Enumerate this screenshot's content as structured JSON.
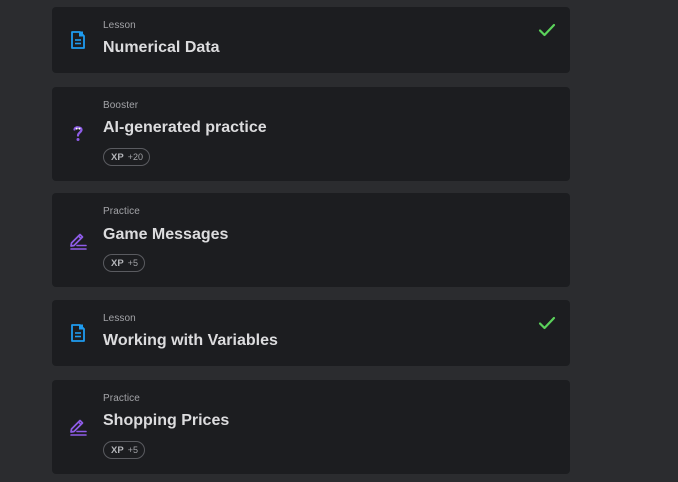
{
  "items": [
    {
      "type": "Lesson",
      "title": "Numerical Data",
      "icon": "document-icon",
      "completed": true
    },
    {
      "type": "Booster",
      "title": "AI-generated practice",
      "icon": "question-mark-icon",
      "xp_label": "XP",
      "xp_value": "+20"
    },
    {
      "type": "Practice",
      "title": "Game Messages",
      "icon": "pencil-lines-icon",
      "xp_label": "XP",
      "xp_value": "+5"
    },
    {
      "type": "Lesson",
      "title": "Working with Variables",
      "icon": "document-icon",
      "completed": true
    },
    {
      "type": "Practice",
      "title": "Shopping Prices",
      "icon": "pencil-lines-icon",
      "xp_label": "XP",
      "xp_value": "+5"
    }
  ],
  "colors": {
    "page_bg": "#2b2c2f",
    "card_bg": "#1c1d20",
    "lesson_icon": "#1e9cf0",
    "practice_icon": "#8e5ce8",
    "check": "#5bd25b"
  }
}
